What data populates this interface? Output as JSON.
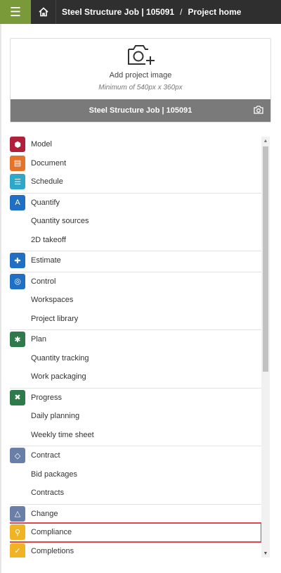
{
  "header": {
    "menu_icon": "hamburger-icon",
    "home_icon": "home-icon",
    "breadcrumb": [
      "Steel Structure Job | 105091",
      "Project home"
    ],
    "separator": "/",
    "menu_color": "#7a9a3a"
  },
  "project_card": {
    "add_image_label": "Add project image",
    "min_size_label": "Minimum of 540px x 360px",
    "project_name": "Steel Structure Job | 105091",
    "camera_icon": "camera-plus-icon"
  },
  "menu": {
    "groups": [
      {
        "items": [
          {
            "label": "Model",
            "icon": "model-icon",
            "color": "#b0203a"
          },
          {
            "label": "Document",
            "icon": "document-icon",
            "color": "#e6732a"
          },
          {
            "label": "Schedule",
            "icon": "schedule-icon",
            "color": "#2fa7c9"
          }
        ]
      },
      {
        "items": [
          {
            "label": "Quantify",
            "icon": "quantify-icon",
            "color": "#1f6fc4"
          },
          {
            "label": "Quantity sources"
          },
          {
            "label": "2D takeoff"
          }
        ]
      },
      {
        "items": [
          {
            "label": "Estimate",
            "icon": "estimate-icon",
            "color": "#1f6fc4"
          }
        ]
      },
      {
        "items": [
          {
            "label": "Control",
            "icon": "control-icon",
            "color": "#1f6fc4"
          },
          {
            "label": "Workspaces"
          },
          {
            "label": "Project library"
          }
        ]
      },
      {
        "items": [
          {
            "label": "Plan",
            "icon": "plan-icon",
            "color": "#2e7a4a"
          },
          {
            "label": "Quantity tracking"
          },
          {
            "label": "Work packaging"
          }
        ]
      },
      {
        "items": [
          {
            "label": "Progress",
            "icon": "progress-icon",
            "color": "#2e7a4a"
          },
          {
            "label": "Daily planning"
          },
          {
            "label": "Weekly time sheet"
          }
        ]
      },
      {
        "items": [
          {
            "label": "Contract",
            "icon": "contract-icon",
            "color": "#6a7fa8"
          },
          {
            "label": "Bid packages"
          },
          {
            "label": "Contracts"
          }
        ]
      },
      {
        "items": [
          {
            "label": "Change",
            "icon": "change-icon",
            "color": "#6a7fa8"
          },
          {
            "label": "Compliance",
            "icon": "compliance-icon",
            "color": "#f0b323",
            "highlighted": true
          },
          {
            "label": "Completions",
            "icon": "completions-icon",
            "color": "#f0b323"
          }
        ]
      }
    ]
  }
}
